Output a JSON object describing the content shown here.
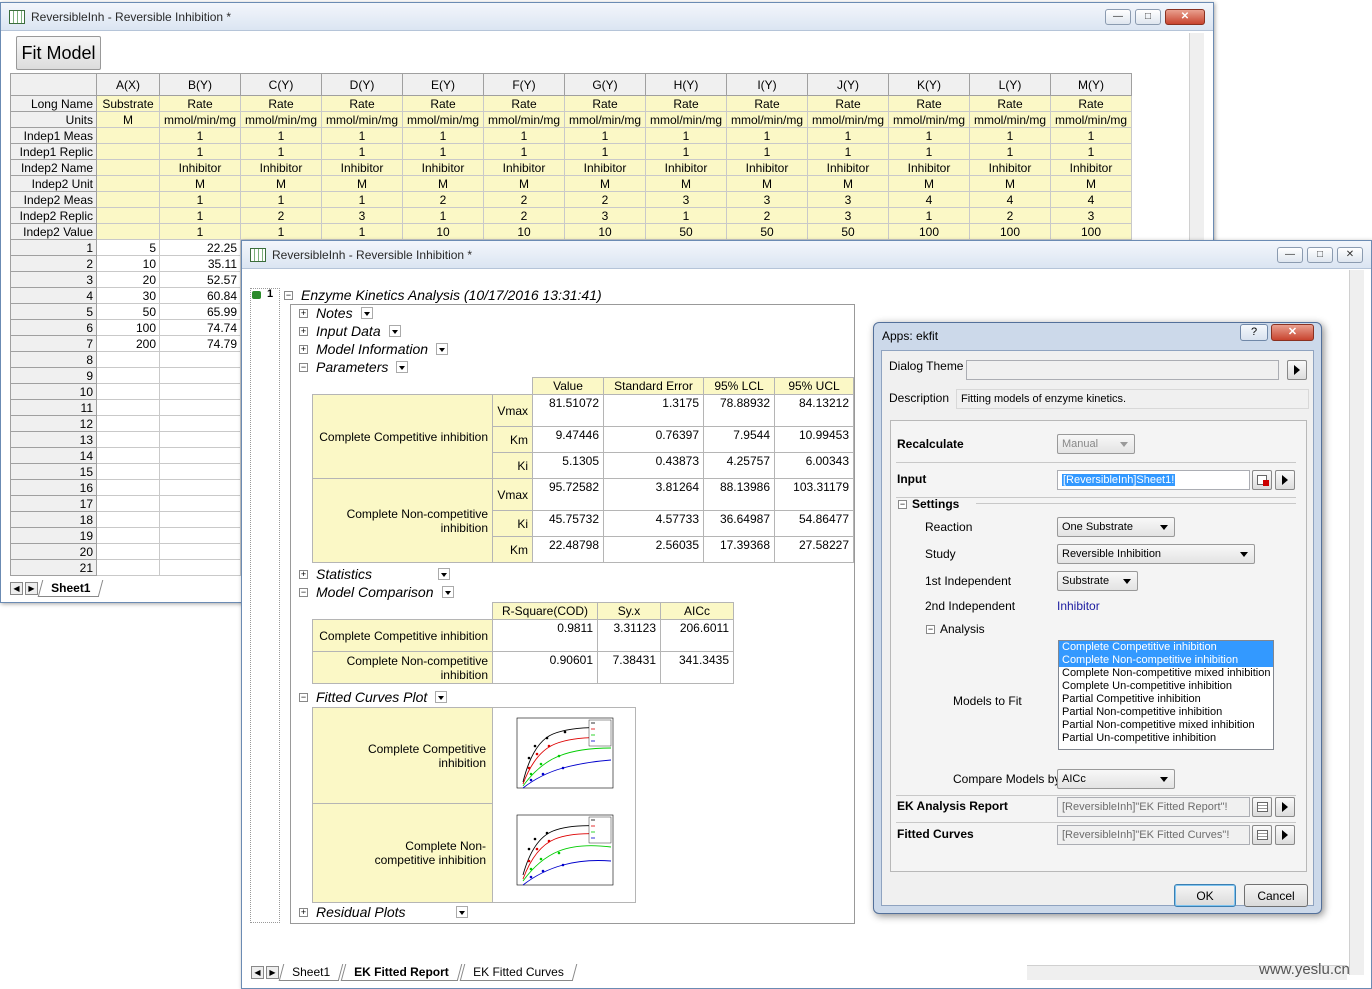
{
  "worksheet_window": {
    "title": "ReversibleInh - Reversible Inhibition *",
    "fit_button": "Fit Model",
    "columns": [
      "A(X)",
      "B(Y)",
      "C(Y)",
      "D(Y)",
      "E(Y)",
      "F(Y)",
      "G(Y)",
      "H(Y)",
      "I(Y)",
      "J(Y)",
      "K(Y)",
      "L(Y)",
      "M(Y)"
    ],
    "meta_rows": [
      {
        "label": "Long Name",
        "cells": [
          "Substrate",
          "Rate",
          "Rate",
          "Rate",
          "Rate",
          "Rate",
          "Rate",
          "Rate",
          "Rate",
          "Rate",
          "Rate",
          "Rate",
          "Rate"
        ]
      },
      {
        "label": "Units",
        "cells": [
          "M",
          "mmol/min/mg",
          "mmol/min/mg",
          "mmol/min/mg",
          "mmol/min/mg",
          "mmol/min/mg",
          "mmol/min/mg",
          "mmol/min/mg",
          "mmol/min/mg",
          "mmol/min/mg",
          "mmol/min/mg",
          "mmol/min/mg",
          "mmol/min/mg"
        ]
      },
      {
        "label": "Indep1 Meas",
        "cells": [
          "",
          "1",
          "1",
          "1",
          "1",
          "1",
          "1",
          "1",
          "1",
          "1",
          "1",
          "1",
          "1"
        ]
      },
      {
        "label": "Indep1 Replic",
        "cells": [
          "",
          "1",
          "1",
          "1",
          "1",
          "1",
          "1",
          "1",
          "1",
          "1",
          "1",
          "1",
          "1"
        ]
      },
      {
        "label": "Indep2 Name",
        "cells": [
          "",
          "Inhibitor",
          "Inhibitor",
          "Inhibitor",
          "Inhibitor",
          "Inhibitor",
          "Inhibitor",
          "Inhibitor",
          "Inhibitor",
          "Inhibitor",
          "Inhibitor",
          "Inhibitor",
          "Inhibitor"
        ]
      },
      {
        "label": "Indep2 Unit",
        "cells": [
          "",
          "M",
          "M",
          "M",
          "M",
          "M",
          "M",
          "M",
          "M",
          "M",
          "M",
          "M",
          "M"
        ]
      },
      {
        "label": "Indep2 Meas",
        "cells": [
          "",
          "1",
          "1",
          "1",
          "2",
          "2",
          "2",
          "3",
          "3",
          "3",
          "4",
          "4",
          "4"
        ]
      },
      {
        "label": "Indep2 Replic",
        "cells": [
          "",
          "1",
          "2",
          "3",
          "1",
          "2",
          "3",
          "1",
          "2",
          "3",
          "1",
          "2",
          "3"
        ]
      },
      {
        "label": "Indep2 Value",
        "cells": [
          "",
          "1",
          "1",
          "1",
          "10",
          "10",
          "10",
          "50",
          "50",
          "50",
          "100",
          "100",
          "100"
        ]
      }
    ],
    "data_rows": [
      {
        "n": "1",
        "a": "5",
        "b": "22.25"
      },
      {
        "n": "2",
        "a": "10",
        "b": "35.11"
      },
      {
        "n": "3",
        "a": "20",
        "b": "52.57"
      },
      {
        "n": "4",
        "a": "30",
        "b": "60.84"
      },
      {
        "n": "5",
        "a": "50",
        "b": "65.99"
      },
      {
        "n": "6",
        "a": "100",
        "b": "74.74"
      },
      {
        "n": "7",
        "a": "200",
        "b": "74.79"
      },
      {
        "n": "8",
        "a": "",
        "b": ""
      },
      {
        "n": "9",
        "a": "",
        "b": ""
      },
      {
        "n": "10",
        "a": "",
        "b": ""
      },
      {
        "n": "11",
        "a": "",
        "b": ""
      },
      {
        "n": "12",
        "a": "",
        "b": ""
      },
      {
        "n": "13",
        "a": "",
        "b": ""
      },
      {
        "n": "14",
        "a": "",
        "b": ""
      },
      {
        "n": "15",
        "a": "",
        "b": ""
      },
      {
        "n": "16",
        "a": "",
        "b": ""
      },
      {
        "n": "17",
        "a": "",
        "b": ""
      },
      {
        "n": "18",
        "a": "",
        "b": ""
      },
      {
        "n": "19",
        "a": "",
        "b": ""
      },
      {
        "n": "20",
        "a": "",
        "b": ""
      },
      {
        "n": "21",
        "a": "",
        "b": ""
      }
    ],
    "sheet_tab": "Sheet1"
  },
  "report_window": {
    "title": "ReversibleInh - Reversible Inhibition *",
    "row_number": "1",
    "root": "Enzyme Kinetics Analysis (10/17/2016 13:31:41)",
    "nodes": {
      "notes": "Notes",
      "input_data": "Input Data",
      "model_info": "Model Information",
      "parameters": "Parameters",
      "statistics": "Statistics",
      "model_comparison": "Model Comparison",
      "fitted_curves_plot": "Fitted Curves Plot",
      "residual_plots": "Residual Plots"
    },
    "parameters_table": {
      "headers": [
        "Value",
        "Standard Error",
        "95% LCL",
        "95% UCL"
      ],
      "models": [
        {
          "name": "Complete Competitive inhibition",
          "rows": [
            {
              "p": "Vmax",
              "v": [
                "81.51072",
                "1.3175",
                "78.88932",
                "84.13212"
              ]
            },
            {
              "p": "Km",
              "v": [
                "9.47446",
                "0.76397",
                "7.9544",
                "10.99453"
              ]
            },
            {
              "p": "Ki",
              "v": [
                "5.1305",
                "0.43873",
                "4.25757",
                "6.00343"
              ]
            }
          ]
        },
        {
          "name": "Complete Non-competitive inhibition",
          "rows": [
            {
              "p": "Vmax",
              "v": [
                "95.72582",
                "3.81264",
                "88.13986",
                "103.31179"
              ]
            },
            {
              "p": "Ki",
              "v": [
                "45.75732",
                "4.57733",
                "36.64987",
                "54.86477"
              ]
            },
            {
              "p": "Km",
              "v": [
                "22.48798",
                "2.56035",
                "17.39368",
                "27.58227"
              ]
            }
          ]
        }
      ]
    },
    "comparison_table": {
      "headers": [
        "R-Square(COD)",
        "Sy.x",
        "AICc"
      ],
      "rows": [
        {
          "name": "Complete Competitive inhibition",
          "v": [
            "0.9811",
            "3.31123",
            "206.6011"
          ]
        },
        {
          "name": "Complete Non-competitive inhibition",
          "v": [
            "0.90601",
            "7.38431",
            "341.3435"
          ]
        }
      ]
    },
    "plots": [
      {
        "name": "Complete Competitive inhibition"
      },
      {
        "name": "Complete Non-competitive inhibition"
      }
    ],
    "tabs": [
      "Sheet1",
      "EK Fitted Report",
      "EK Fitted Curves"
    ]
  },
  "dialog": {
    "title": "Apps: ekfit",
    "help_label": "?",
    "theme_label": "Dialog Theme",
    "theme_value": "",
    "description_label": "Description",
    "description_value": "Fitting models of enzyme kinetics.",
    "recalculate_label": "Recalculate",
    "recalculate_value": "Manual",
    "input_label": "Input",
    "input_value": "[ReversibleInh]Sheet1!",
    "settings_label": "Settings",
    "reaction_label": "Reaction",
    "reaction_value": "One Substrate",
    "study_label": "Study",
    "study_value": "Reversible Inhibition",
    "indep1_label": "1st Independent",
    "indep1_value": "Substrate",
    "indep2_label": "2nd Independent",
    "indep2_value": "Inhibitor",
    "analysis_label": "Analysis",
    "models_label": "Models to Fit",
    "models": [
      {
        "name": "Complete Competitive inhibition",
        "selected": true
      },
      {
        "name": "Complete Non-competitive inhibition",
        "selected": true
      },
      {
        "name": "Complete Non-competitive mixed inhibition",
        "selected": false
      },
      {
        "name": "Complete Un-competitive inhibition",
        "selected": false
      },
      {
        "name": "Partial Competitive inhibition",
        "selected": false
      },
      {
        "name": "Partial Non-competitive inhibition",
        "selected": false
      },
      {
        "name": "Partial Non-competitive mixed inhibition",
        "selected": false
      },
      {
        "name": "Partial Un-competitive inhibition",
        "selected": false
      }
    ],
    "compare_label": "Compare Models by",
    "compare_value": "AICc",
    "report_label": "EK Analysis Report",
    "report_value": "[ReversibleInh]\"EK Fitted Report\"!",
    "curves_label": "Fitted Curves",
    "curves_value": "[ReversibleInh]\"EK Fitted Curves\"!",
    "ok": "OK",
    "cancel": "Cancel"
  },
  "watermark": "www.yeslu.cn",
  "colors": {
    "accent": "#3399ff",
    "header_yellow": "#fbf8c6"
  }
}
